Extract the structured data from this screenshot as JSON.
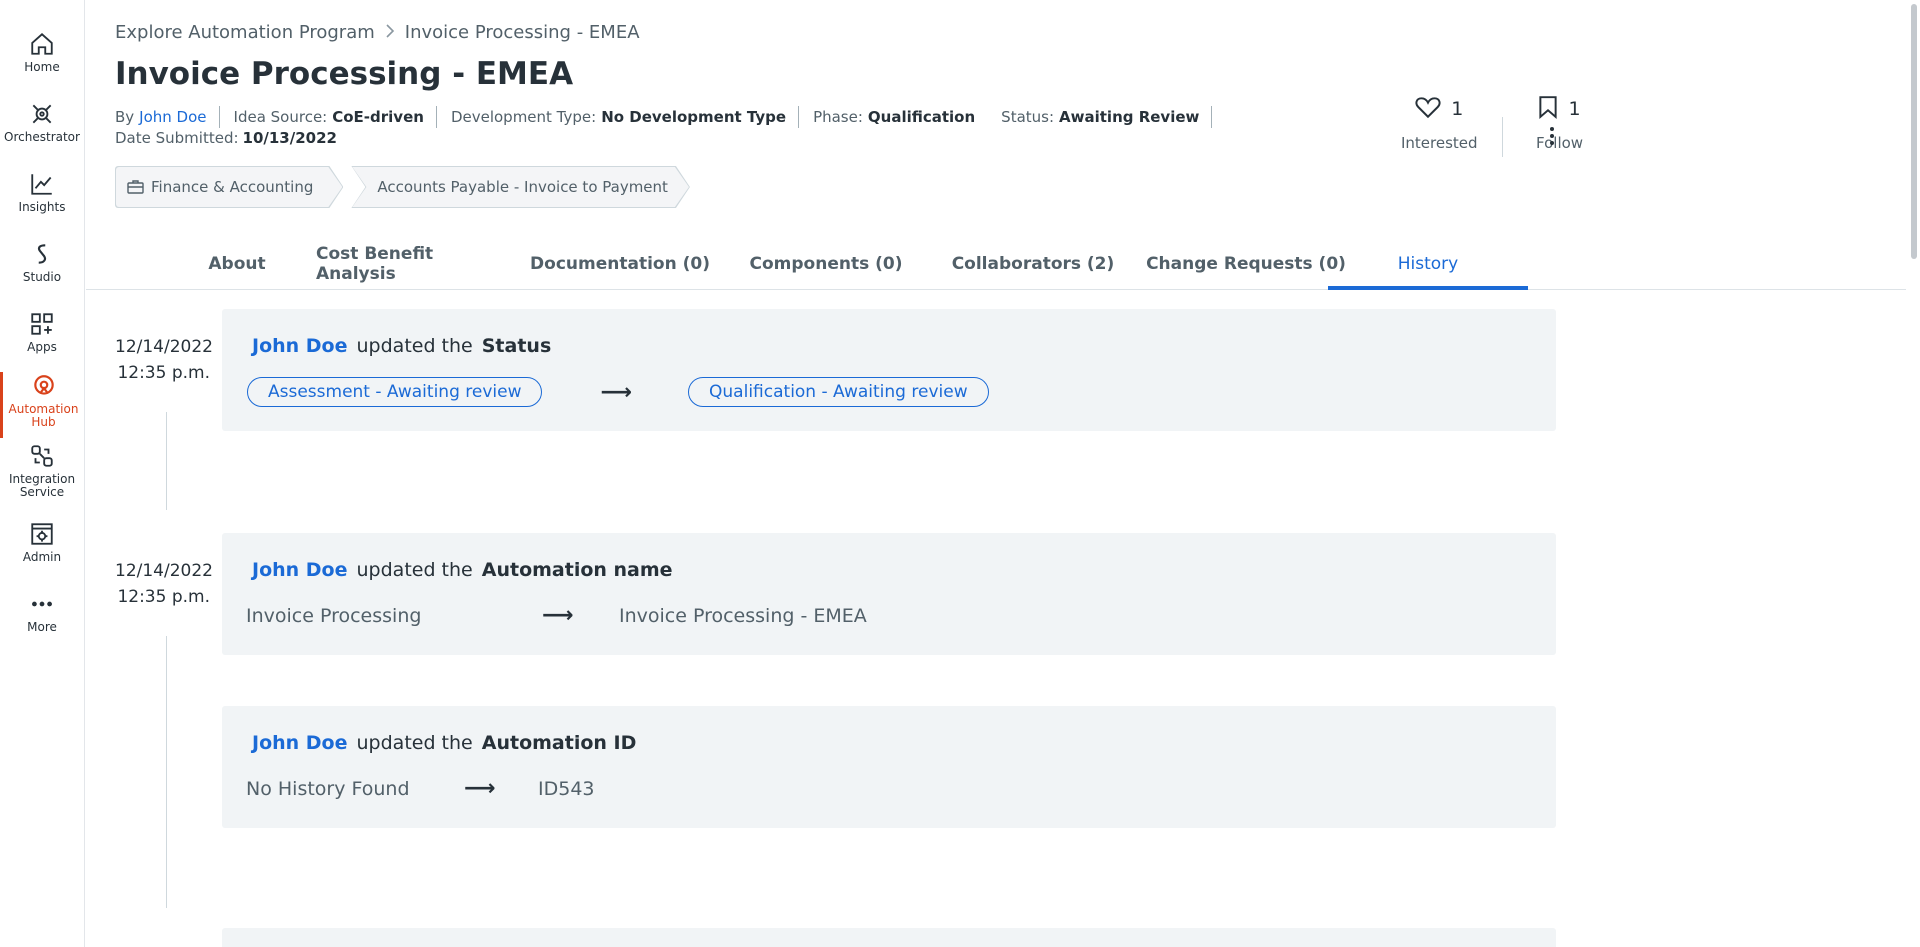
{
  "rail": {
    "items": [
      {
        "label": "Home",
        "icon": "home-icon"
      },
      {
        "label": "Orchestrator",
        "icon": "orchestrator-icon"
      },
      {
        "label": "Insights",
        "icon": "insights-chart-icon"
      },
      {
        "label": "Studio",
        "icon": "studio-icon"
      },
      {
        "label": "Apps",
        "icon": "apps-grid-icon"
      },
      {
        "label": "Automation Hub",
        "icon": "automation-hub-icon",
        "active": true
      },
      {
        "label": "Integration Service",
        "icon": "integration-service-icon"
      },
      {
        "label": "Admin",
        "icon": "admin-icon"
      },
      {
        "label": "More",
        "icon": "more-dots-icon"
      }
    ],
    "accent_color": "#d9421b"
  },
  "breadcrumb": {
    "parent": "Explore Automation Program",
    "current": "Invoice Processing - EMEA"
  },
  "page": {
    "title": "Invoice Processing - EMEA"
  },
  "meta": {
    "by_label": "By",
    "by_value": "John Doe",
    "source_label": "Idea Source:",
    "source_value": "CoE-driven",
    "devtype_label": "Development Type:",
    "devtype_value": "No Development Type",
    "phase_label": "Phase:",
    "phase_value": "Qualification",
    "status_label": "Status:",
    "status_value": "Awaiting Review",
    "submitted_label": "Date Submitted:",
    "submitted_value": "10/13/2022"
  },
  "tags": {
    "category": "Finance & Accounting",
    "subcategory": "Accounts Payable - Invoice to Payment"
  },
  "actions": {
    "interested_count": "1",
    "interested_label": "Interested",
    "follow_count": "1",
    "follow_label": "Follow"
  },
  "tabs": [
    {
      "label": "About"
    },
    {
      "label": "Cost Benefit Analysis"
    },
    {
      "label": "Documentation (0)"
    },
    {
      "label": "Components (0)"
    },
    {
      "label": "Collaborators (2)"
    },
    {
      "label": "Change Requests (0)"
    },
    {
      "label": "History",
      "active": true
    }
  ],
  "history": [
    {
      "date": "12/14/2022",
      "time": "12:35 p.m.",
      "user": "John Doe",
      "verb": "updated the",
      "field": "Status",
      "from": "Assessment - Awaiting review",
      "to": "Qualification - Awaiting review",
      "style": "pill"
    },
    {
      "date": "12/14/2022",
      "time": "12:35 p.m.",
      "user": "John Doe",
      "verb": "updated the",
      "field": "Automation name",
      "from": "Invoice Processing",
      "to": "Invoice Processing - EMEA"
    },
    {
      "user": "John Doe",
      "verb": "updated the",
      "field": "Automation ID",
      "from": "No History Found",
      "to": "ID543"
    }
  ],
  "arrow_glyph": "⟶",
  "colors": {
    "link": "#1b6ad6",
    "card_bg": "#f1f4f6",
    "text": "#273139"
  }
}
